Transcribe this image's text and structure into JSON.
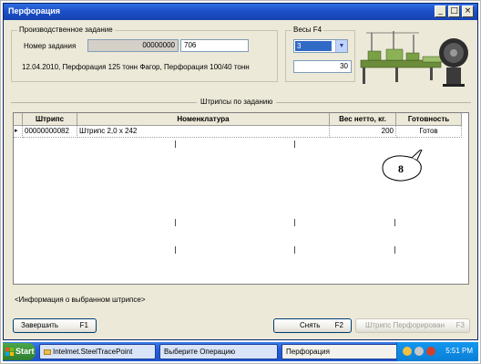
{
  "window": {
    "title": "Перфорация",
    "controls": {
      "minimize": "_",
      "maximize": "□",
      "close": "×"
    }
  },
  "production_task": {
    "group_label": "Производственное задание",
    "task_number_label": "Номер задания",
    "task_number_prefix": "00000000",
    "task_number_value": "706",
    "description": "12.04.2010, Перфорация 125 тонн Фагор, Перфорация 100/40 тонн"
  },
  "scales": {
    "group_label": "Весы  F4",
    "selected": "3",
    "value": "30"
  },
  "section_title": "Штрипсы по заданию",
  "grid": {
    "columns": [
      "Штрипс",
      "Номенклатура",
      "Вес нетто, кг.",
      "Готовность"
    ],
    "rows": [
      {
        "marker": "▸",
        "strip": "00000000082",
        "nomenclature": "Штрипс 2,0 х 242",
        "net_weight": "200",
        "readiness": "Готов"
      }
    ]
  },
  "callout_number": "8",
  "info_text": "<Информация о выбранном штрипсе>",
  "buttons": {
    "finish": {
      "label": "Завершить",
      "key": "F1"
    },
    "remove": {
      "label": "Снять",
      "key": "F2"
    },
    "strip_perforated": {
      "label": "Штрипс Перфорирован",
      "key": "F3"
    }
  },
  "taskbar": {
    "start_label": "Start",
    "tasks": [
      "Intelmet.SteelTracePoint",
      "Выберите Операцию",
      "Перфорация"
    ],
    "clock": "5:51 PM"
  },
  "colors": {
    "titlebar": "#1c4fc8",
    "window_bg": "#ece9d8",
    "taskbar": "#245edb",
    "selection": "#316ac5"
  }
}
